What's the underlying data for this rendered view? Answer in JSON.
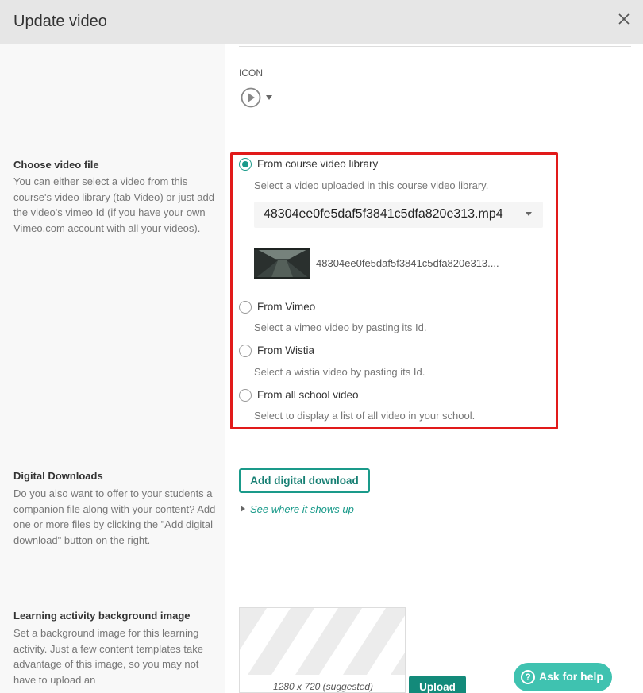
{
  "header": {
    "title": "Update video"
  },
  "icon_section": {
    "label": "ICON",
    "icon": "play-circle-icon"
  },
  "video_file": {
    "title": "Choose video file",
    "description": "You can either select a video from this course's video library (tab Video) or just add the video's vimeo Id (if you have your own Vimeo.com account with all your videos).",
    "options": [
      {
        "label": "From course video library",
        "help": "Select a video uploaded in this course video library.",
        "checked": true
      },
      {
        "label": "From Vimeo",
        "help": "Select a vimeo video by pasting its Id.",
        "checked": false
      },
      {
        "label": "From Wistia",
        "help": "Select a wistia video by pasting its Id.",
        "checked": false
      },
      {
        "label": "From all school video",
        "help": "Select to display a list of all video in your school.",
        "checked": false
      }
    ],
    "selected_file": "48304ee0fe5daf5f3841c5dfa820e313.mp4",
    "thumbnail_name": "48304ee0fe5daf5f3841c5dfa820e313...."
  },
  "digital_downloads": {
    "title": "Digital Downloads",
    "description": "Do you also want to offer to your students a companion file along with your content? Add one or more files by clicking the \"Add digital download\" button on the right.",
    "button": "Add digital download",
    "see_where": "See where it shows up"
  },
  "background_image": {
    "title": "Learning activity background image",
    "description": "Set a background image for this learning activity. Just a few content templates take advantage of this image, so you may not have to upload an",
    "caption": "1280 x 720 (suggested)",
    "upload_button": "Upload"
  },
  "help": {
    "label": "Ask for help",
    "icon": "question-circle-icon"
  },
  "colors": {
    "accent": "#1a9a8a",
    "highlight_border": "#e11a1a",
    "help_button": "#3fc2b0"
  }
}
